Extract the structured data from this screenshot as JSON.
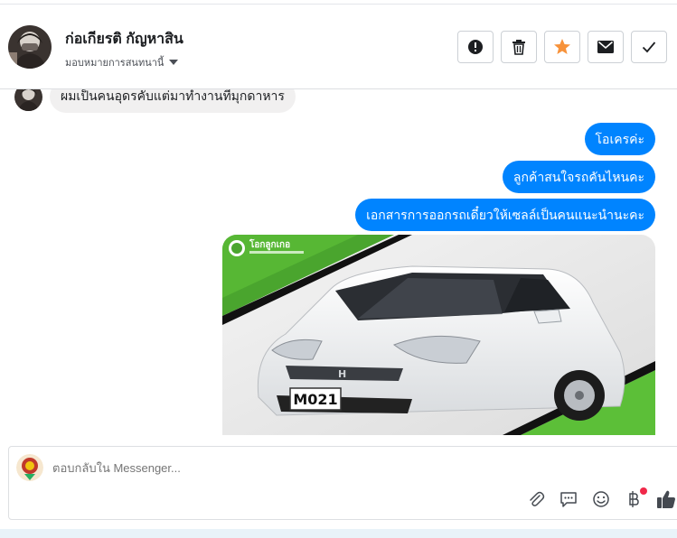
{
  "header": {
    "contact_name": "ก่อเกียรติ กัญหาสิน",
    "assign_label": "มอบหมายการสนทนานี้"
  },
  "actions": [
    {
      "icon": "alert-icon"
    },
    {
      "icon": "trash-icon"
    },
    {
      "icon": "star-icon",
      "color": "#f7923a"
    },
    {
      "icon": "envelope-icon"
    },
    {
      "icon": "check-icon"
    }
  ],
  "thread": {
    "incoming_text": "ผมเป็นคนอุดรคับแต่มาทำงานที่มุกดาหาร",
    "outgoing": [
      "โอเครค่ะ",
      "ลูกค้าสนใจรถคันไหนคะ",
      "เอกสารการออกรถเดี๋ยวให้เซลล์เป็นคนแนะนำนะคะ"
    ],
    "photo": {
      "brand_text": "โอกลูกเกอ",
      "plate": "M021"
    }
  },
  "composer": {
    "placeholder": "ตอบกลับใน Messenger..."
  },
  "colors": {
    "outgoing_bubble": "#0084ff",
    "incoming_bubble": "#f1f0f0",
    "star": "#f7923a",
    "notification_dot": "#f02849"
  }
}
